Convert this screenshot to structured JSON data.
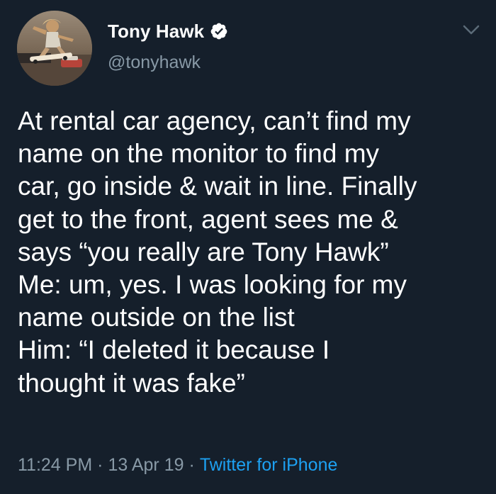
{
  "author": {
    "display_name": "Tony Hawk",
    "handle": "@tonyhawk",
    "verified": true
  },
  "tweet": {
    "lines": [
      "At rental car agency, can’t find my",
      "name on the monitor to find my",
      "car, go inside & wait in line. Finally",
      "get to the front, agent sees me &",
      "says “you really are Tony Hawk”",
      "Me: um, yes. I was looking for my",
      "name outside on the list",
      "Him: “I deleted it because I",
      "thought it was fake”"
    ]
  },
  "meta": {
    "time": "11:24 PM",
    "separator": "·",
    "date": "13 Apr 19",
    "source": "Twitter for iPhone"
  },
  "icons": {
    "verified": "verified-badge-icon",
    "menu": "chevron-down-icon"
  },
  "colors": {
    "background": "#151f2b",
    "text": "#ffffff",
    "secondary": "#8899a6",
    "accent": "#1da1f2"
  }
}
